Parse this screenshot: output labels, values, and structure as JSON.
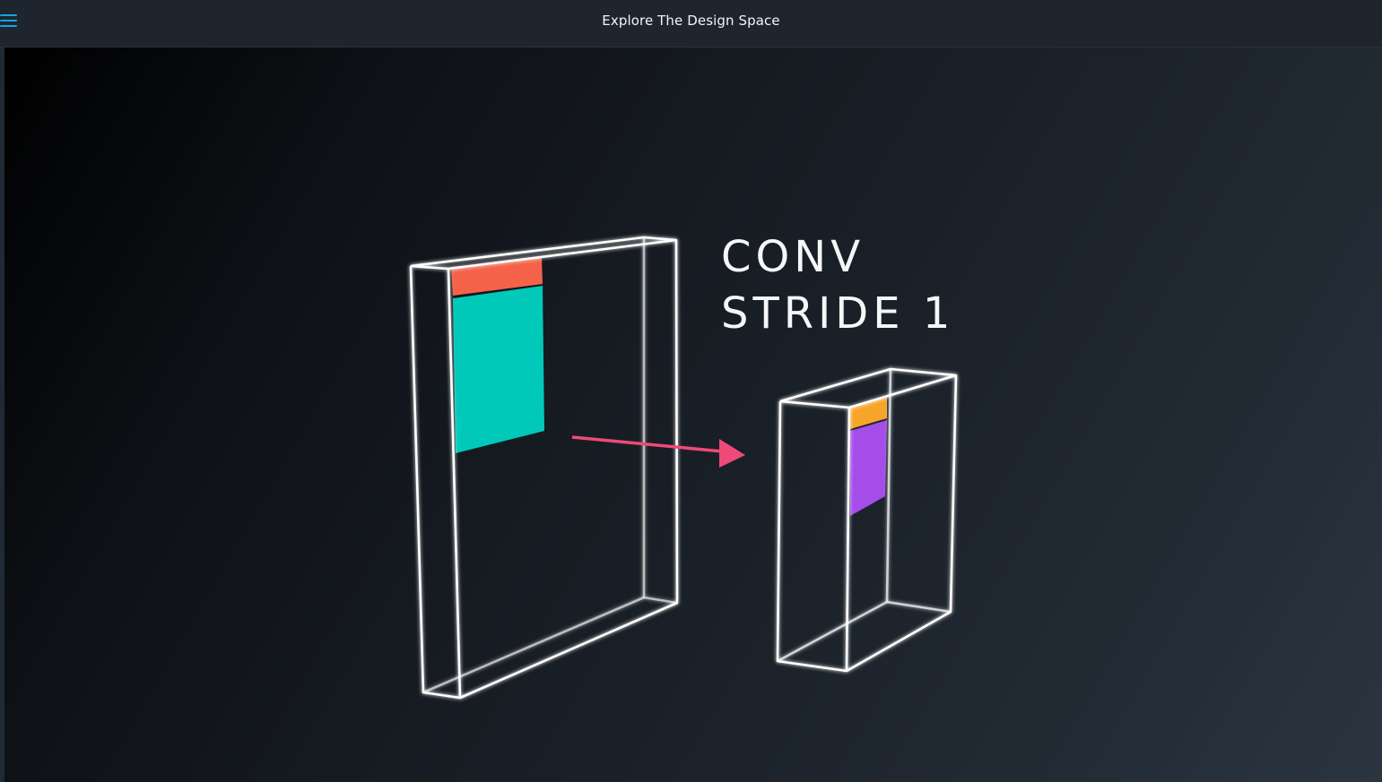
{
  "header": {
    "title": "Explore The Design Space",
    "menu_icon": "hamburger-menu-icon"
  },
  "video": {
    "label_line1": "CONV",
    "label_line2": "STRIDE 1",
    "colors": {
      "patch_top": "#f5624a",
      "patch_main": "#00c9b9",
      "arrow": "#ee4a78",
      "output_top": "#f7a42b",
      "output_main": "#a54de8",
      "wireframe": "#ffffff"
    }
  }
}
